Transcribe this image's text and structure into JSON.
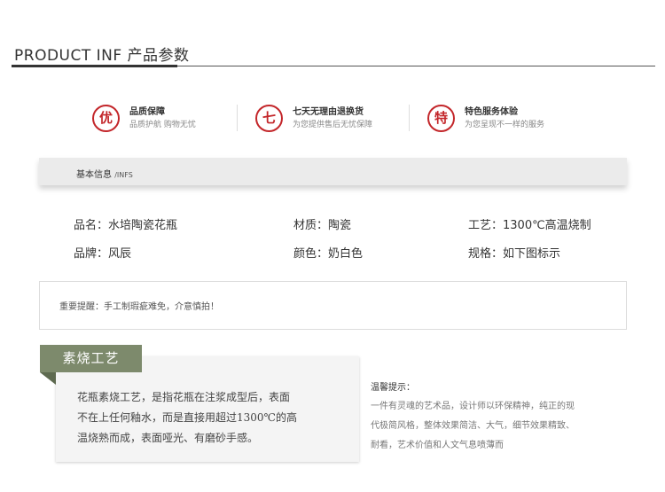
{
  "header": {
    "title": "PRODUCT INF 产品参数"
  },
  "guarantees": [
    {
      "glyph": "优",
      "title": "品质保障",
      "subtitle": "品质护航 购物无忧"
    },
    {
      "glyph": "七",
      "title": "七天无理由退换货",
      "subtitle": "为您提供售后无忧保障"
    },
    {
      "glyph": "特",
      "title": "特色服务体验",
      "subtitle": "为您呈现不一样的服务"
    }
  ],
  "info": {
    "label": "基本信息",
    "label_en": "/INFS"
  },
  "specs": {
    "name": "品名：水培陶瓷花瓶",
    "material": "材质：陶瓷",
    "craft": "工艺：1300℃高温烧制",
    "brand": "品牌：风辰",
    "color": "颜色：奶白色",
    "size": "规格：如下图标示"
  },
  "notice": "重要提醒：手工制瑕疵难免，介意慎拍！",
  "craft_section": {
    "tag": "素烧工艺",
    "lines": [
      "花瓶素烧工艺，是指花瓶在注浆成型后，表面",
      "不在上任何釉水，而是直接用超过1300℃的高",
      "温烧熟而成，表面哑光、有磨砂手感。"
    ]
  },
  "tips": {
    "title": "温馨提示：",
    "lines": [
      "一件有灵魂的艺术品，设计师以环保精神，纯正的现",
      "代极简风格，整体效果简洁、大气，细节效果精致、",
      "耐看，艺术价值和人文气息喷薄而"
    ]
  },
  "colors": {
    "accent_red": "#c3262a",
    "tag_green": "#7d8a6c"
  }
}
